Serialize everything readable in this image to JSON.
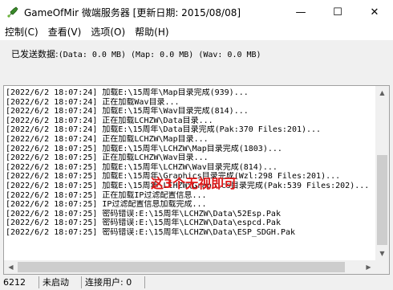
{
  "window": {
    "title": "GameOfMir 微端服务器 [更新日期: 2015/08/08]"
  },
  "title_controls": {
    "minimize": "—",
    "maximize": "☐",
    "close": "✕"
  },
  "menu": [
    {
      "label": "控制(C)"
    },
    {
      "label": "查看(V)"
    },
    {
      "label": "选项(O)"
    },
    {
      "label": "帮助(H)"
    }
  ],
  "stats": {
    "label": "已发送数据:",
    "value": "(Data: 0.0 MB) (Map: 0.0 MB) (Wav: 0.0 MB)"
  },
  "log": [
    "[2022/6/2 18:07:24] 加载E:\\15周年\\Map目录完成(939)...",
    "[2022/6/2 18:07:24] 正在加载Wav目录...",
    "[2022/6/2 18:07:24] 加载E:\\15周年\\Wav目录完成(814)...",
    "[2022/6/2 18:07:24] 正在加载LCHZW\\Data目录...",
    "[2022/6/2 18:07:24] 加载E:\\15周年\\Data目录完成(Pak:370 Files:201)...",
    "[2022/6/2 18:07:24] 正在加载LCHZW\\Map目录...",
    "[2022/6/2 18:07:25] 加载E:\\15周年\\LCHZW\\Map目录完成(1803)...",
    "[2022/6/2 18:07:25] 正在加载LCHZW\\Wav目录...",
    "[2022/6/2 18:07:25] 加载E:\\15周年\\LCHZW\\Wav目录完成(814)...",
    "[2022/6/2 18:07:25] 加载E:\\15周年\\Graphics目录完成(Wzl:298 Files:201)...",
    "[2022/6/2 18:07:25] 加载E:\\15周年\\LCHZW\\Graphics目录完成(Pak:539 Files:202)...",
    "[2022/6/2 18:07:25] 正在加载IP过滤配置信息...",
    "[2022/6/2 18:07:25] IP过滤配置信息加载完成...",
    "[2022/6/2 18:07:25] 密码错误:E:\\15周年\\LCHZW\\Data\\52Esp.Pak",
    "[2022/6/2 18:07:25] 密码错误:E:\\15周年\\LCHZW\\Data\\espcd.Pak",
    "[2022/6/2 18:07:25] 密码错误:E:\\15周年\\LCHZW\\Data\\ESP_SDGH.Pak"
  ],
  "annotation": "这3个无视即可",
  "statusbar": {
    "port": "6212",
    "state": "未启动",
    "users": "连接用户: 0"
  },
  "colors": {
    "annotation": "#e01a1a",
    "icon_green": "#3a8a2a"
  },
  "icons": {
    "app": "mir-sword-icon"
  }
}
